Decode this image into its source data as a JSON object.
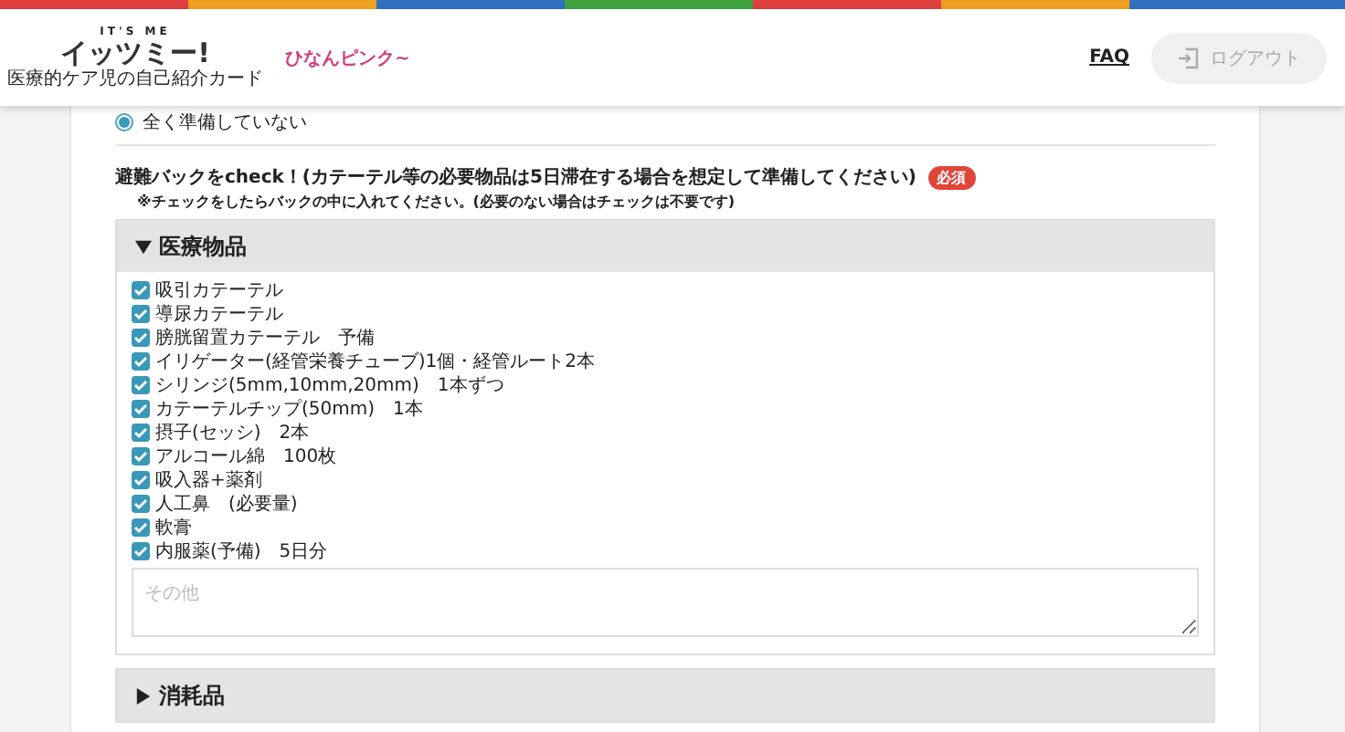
{
  "header": {
    "logo_tagline": "IT'S ME",
    "logo_title": "イッツミー!",
    "logo_subtitle": "医療的ケア児の自己紹介カード",
    "partner_logo": "ひなんピンク~",
    "faq": "FAQ",
    "logout": {
      "label": "ログアウト",
      "disabled": true
    }
  },
  "previous_option": {
    "label": "全く準備していない",
    "selected": true
  },
  "question": {
    "title": "避難バックをcheck！(カテーテル等の必要物品は5日滞在する場合を想定して準備してください)",
    "required": "必須",
    "note": "※チェックをしたらバックの中に入れてください。(必要のない場合はチェックは不要です)"
  },
  "groups": [
    {
      "title": "医療物品",
      "expanded": true,
      "items": [
        {
          "label": "吸引カテーテル",
          "checked": true
        },
        {
          "label": "導尿カテーテル",
          "checked": true
        },
        {
          "label": "膀胱留置カテーテル　予備",
          "checked": true
        },
        {
          "label": "イリゲーター(経管栄養チューブ)1個・経管ルート2本",
          "checked": true
        },
        {
          "label": "シリンジ(5mm,10mm,20mm)　1本ずつ",
          "checked": true
        },
        {
          "label": "カテーテルチップ(50mm)　1本",
          "checked": true
        },
        {
          "label": "摂子(セッシ)　2本",
          "checked": true
        },
        {
          "label": "アルコール綿　100枚",
          "checked": true
        },
        {
          "label": "吸入器+薬剤",
          "checked": true
        },
        {
          "label": "人工鼻　(必要量)",
          "checked": true
        },
        {
          "label": "軟膏",
          "checked": true
        },
        {
          "label": "内服薬(予備)　5日分",
          "checked": true
        }
      ],
      "other": {
        "placeholder": "その他"
      }
    },
    {
      "title": "消耗品",
      "expanded": false
    }
  ]
}
